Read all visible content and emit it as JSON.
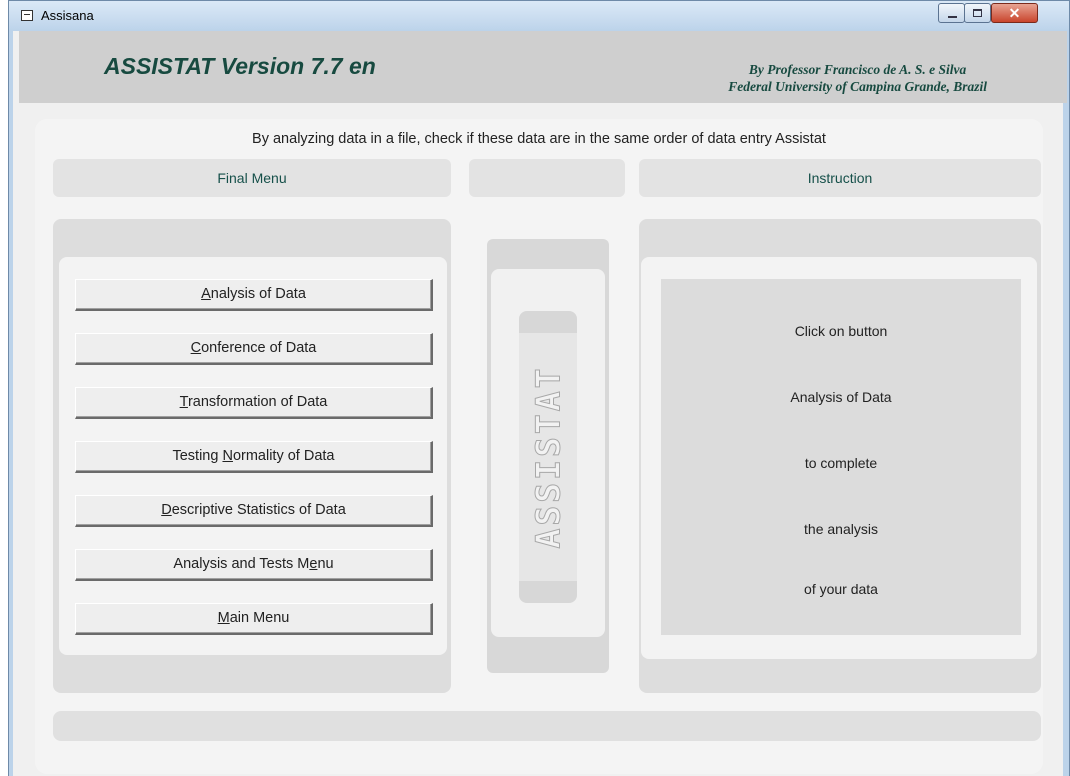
{
  "window": {
    "title": "Assisana"
  },
  "header": {
    "app_title": "ASSISTAT Version 7.7 en",
    "author_line1": "By Professor Francisco de A. S. e Silva",
    "author_line2": "Federal University of Campina Grande, Brazil"
  },
  "notice": "By analyzing data in a file, check if these data are in the same order of data entry Assistat",
  "tabs": {
    "left": "Final Menu",
    "middle": "",
    "right": "Instruction"
  },
  "menu": {
    "buttons": [
      {
        "pre": "",
        "key": "A",
        "post": "nalysis of Data"
      },
      {
        "pre": "",
        "key": "C",
        "post": "onference of Data"
      },
      {
        "pre": "",
        "key": "T",
        "post": "ransformation of Data"
      },
      {
        "pre": "Testing ",
        "key": "N",
        "post": "ormality of Data"
      },
      {
        "pre": "",
        "key": "D",
        "post": "escriptive Statistics of Data"
      },
      {
        "pre": "Analysis and Tests M",
        "key": "e",
        "post": "nu"
      },
      {
        "pre": "",
        "key": "M",
        "post": "ain Menu"
      }
    ]
  },
  "logo": {
    "text": "ASSISTAT"
  },
  "instruction": {
    "lines": [
      "Click on button",
      "Analysis of Data",
      "to complete",
      "the analysis",
      "of your data"
    ]
  },
  "colors": {
    "accent_text": "#174a40",
    "tab_text": "#16504a",
    "panel_bg": "#dddddd"
  },
  "icons": {
    "window_icon": "window-app-icon",
    "minimize": "minimize-icon",
    "maximize": "maximize-icon",
    "close": "close-icon"
  }
}
